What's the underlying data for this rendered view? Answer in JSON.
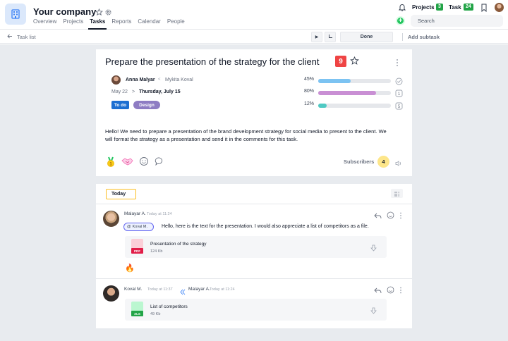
{
  "header": {
    "company": "Your company",
    "nav": [
      "Overview",
      "Projects",
      "Tasks",
      "Reports",
      "Calendar",
      "People"
    ],
    "active_nav": "Tasks",
    "projects_label": "Projects",
    "projects_count": "3",
    "task_label": "Task",
    "task_count": "24",
    "search_placeholder": "Search"
  },
  "subbar": {
    "back_label": "Task list",
    "done_label": "Done",
    "add_subtask": "Add subtask"
  },
  "task": {
    "title": "Prepare the presentation of the strategy for the client",
    "number": "9",
    "assignee": "Anna Malyar",
    "reporter": "Mykita Koval",
    "date_start": "May 22",
    "date_end": "Thursday, July 15",
    "status_tag": "To do",
    "category_tag": "Design",
    "progress": [
      {
        "label": "45%",
        "value": 0.45,
        "color": "#7cc3f2",
        "icon": "check-circle-icon"
      },
      {
        "label": "80%",
        "value": 0.8,
        "color": "#c98fd4",
        "icon": "count-box-icon",
        "icon_text": "1"
      },
      {
        "label": "12%",
        "value": 0.12,
        "color": "#4fc9c3",
        "icon": "count-box-icon",
        "icon_text": "5"
      }
    ],
    "description": "Hello! We need to prepare a presentation of the brand development strategy for social media to present to the client. We will format the strategy as a presentation and send it in the comments for this task.",
    "reaction_icons": [
      "medal-icon",
      "handshake-icon",
      "smile-icon",
      "comment-icon"
    ],
    "subscribers_label": "Subscribers",
    "subscribers_count": "4"
  },
  "comments_section": {
    "date_chip": "Today",
    "comments": [
      {
        "author": "Malayar A.",
        "time": "Today at 11:24",
        "mention": "Koval M.",
        "text": "Hello, here is the text for the presentation. I would also appreciate a list of competitors as a file.",
        "file_name": "Presentation of the strategy",
        "file_size": "124 Kb",
        "file_ext": "PDF",
        "file_color": "#e11d48",
        "reaction": "🔥"
      },
      {
        "author": "Koval M.",
        "time": "Today at 11:37",
        "reply_author": "Malayar A.",
        "reply_time": "Today at 11:24",
        "file_name": "List of competitors",
        "file_size": "49 Kb",
        "file_ext": "XLS",
        "file_color": "#22a447"
      }
    ]
  }
}
